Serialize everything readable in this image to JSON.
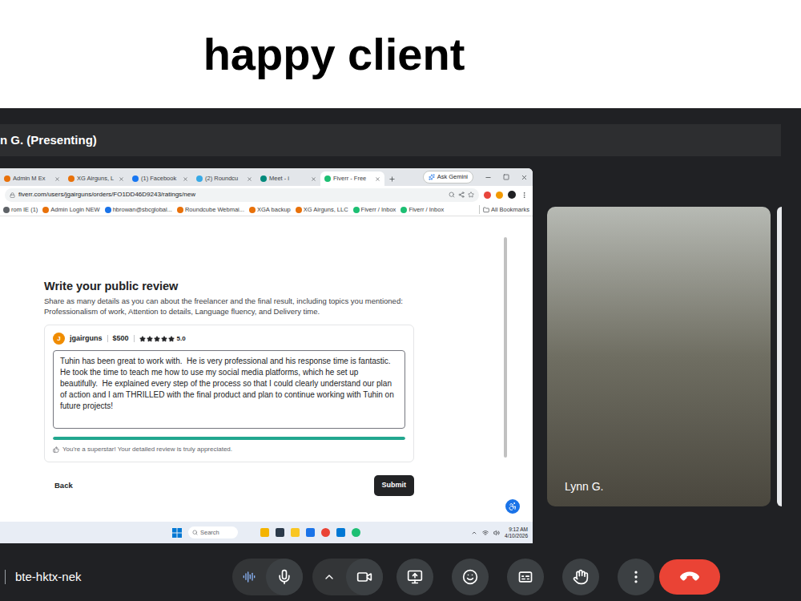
{
  "header": {
    "title": "happy client"
  },
  "presenter_bar": {
    "label": "n G. (Presenting)"
  },
  "browser": {
    "tabs": [
      {
        "label": "Admin M Ex",
        "selected": false,
        "color": "#e8710a"
      },
      {
        "label": "XG Airguns, L",
        "selected": false,
        "color": "#e8710a"
      },
      {
        "label": "(1) Facebook",
        "selected": false,
        "color": "#1877f2"
      },
      {
        "label": "(2) Roundcu",
        "selected": false,
        "color": "#37a9e6"
      },
      {
        "label": "Meet - i",
        "selected": false,
        "color": "#00897b"
      },
      {
        "label": "Fiverr - Free",
        "selected": true,
        "color": "#1dbf73"
      }
    ],
    "gemini": "Ask Gemini",
    "url": "fiverr.com/users/jgairguns/orders/FO1DD46D9243/ratings/new",
    "bookmarks": [
      {
        "label": "rom IE (1)",
        "color": "#5f6368"
      },
      {
        "label": "Admin Login NEW",
        "color": "#e8710a"
      },
      {
        "label": "hbrowan@sbcglobal...",
        "color": "#1a73e8"
      },
      {
        "label": "Roundcube Webmai...",
        "color": "#e8710a"
      },
      {
        "label": "XGA backup",
        "color": "#e8710a"
      },
      {
        "label": "XG Airguns, LLC",
        "color": "#e8710a"
      },
      {
        "label": "Fiverr / Inbox",
        "color": "#1dbf73"
      },
      {
        "label": "Fiverr / Inbox",
        "color": "#1dbf73"
      }
    ],
    "all_bookmarks": "All Bookmarks"
  },
  "review": {
    "title": "Write your public review",
    "description": "Share as many details as you can about the freelancer and the final result, including topics you mentioned: Professionalism of work, Attention to details, Language fluency, and Delivery time.",
    "avatar": "J",
    "seller": "jgairguns",
    "price": "$500",
    "stars": 5,
    "rating": "5.0",
    "text": "Tuhin has been great to work with.  He is very professional and his response time is fantastic.  He took the time to teach me how to use my social media platforms, which he set up beautifully.  He explained every step of the process so that I could clearly understand our plan of action and I am THRILLED with the final product and plan to continue working with Tuhin on future projects!",
    "progress": {
      "level": 1
    },
    "note": "You're a superstar! Your detailed review is truly appreciated.",
    "back": "Back",
    "submit": "Submit"
  },
  "taskbar": {
    "search": "Search",
    "time": "9:12 AM",
    "date": "4/10/2026"
  },
  "participant": {
    "name": "Lynn G."
  },
  "meeting": {
    "code": "bte-hktx-nek"
  }
}
